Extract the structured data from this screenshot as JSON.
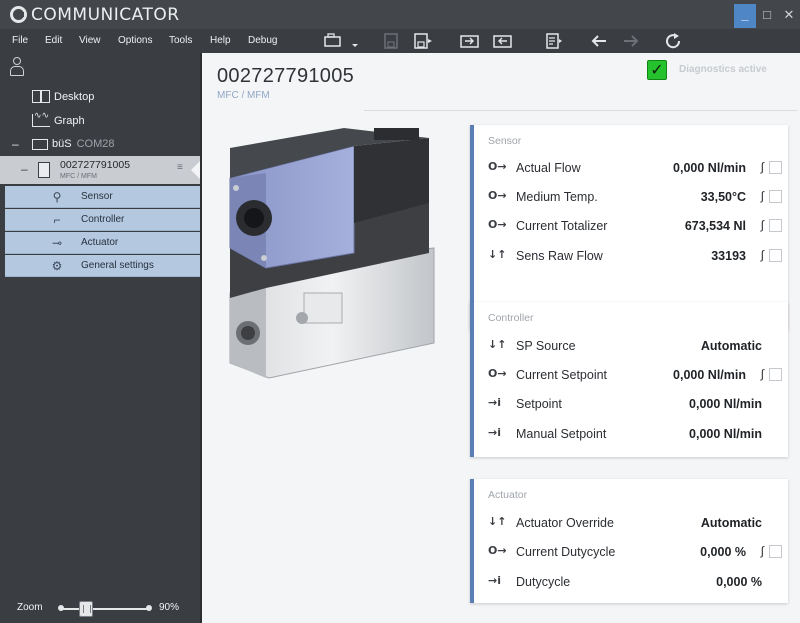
{
  "window": {
    "title": "COMMUNICATOR",
    "controls": [
      "_",
      "□",
      "✕"
    ]
  },
  "menu": [
    "File",
    "Edit",
    "View",
    "Options",
    "Tools",
    "Help",
    "Debug"
  ],
  "toolbar": {
    "icons": [
      "device-icon",
      "dropdown-icon",
      "save-disabled-icon",
      "save-icon",
      "import-icon",
      "export-icon",
      "report-icon",
      "back-icon",
      "forward-icon",
      "refresh-icon"
    ]
  },
  "sidebar": {
    "desktop": "Desktop",
    "graph": "Graph",
    "bus": "büS",
    "bus_port": "COM28",
    "collapse_symbol": "–",
    "device_id": "002727791005",
    "device_type": "MFC / MFM",
    "sub_items": [
      "Sensor",
      "Controller",
      "Actuator",
      "General settings"
    ],
    "zoom_label": "Zoom",
    "zoom_value": "90%",
    "zoom_level": 0.28
  },
  "main": {
    "device_id": "002727791005",
    "device_type": "MFC / MFM",
    "diagnostics_label": "Diagnostics active",
    "diagnostics_checked": true
  },
  "cards": [
    {
      "title": "Sensor",
      "rows": [
        {
          "icon": "O→",
          "label": "Actual Flow",
          "value": "0,000 Nl/min",
          "trend": true,
          "check": true
        },
        {
          "icon": "O→",
          "label": "Medium Temp.",
          "value": "33,50°C",
          "trend": true,
          "check": true
        },
        {
          "icon": "O→",
          "label": "Current Totalizer",
          "value": "673,534 Nl",
          "trend": true,
          "check": true
        },
        {
          "icon": "↓↑",
          "label": "Sens Raw Flow",
          "value": "33193",
          "trend": true,
          "check": true
        }
      ]
    },
    {
      "title": "Controller",
      "rows": [
        {
          "icon": "↓↑",
          "label": "SP Source",
          "value": "Automatic",
          "trend": false,
          "check": false
        },
        {
          "icon": "O→",
          "label": "Current Setpoint",
          "value": "0,000 Nl/min",
          "trend": true,
          "check": true
        },
        {
          "icon": "→i",
          "label": "Setpoint",
          "value": "0,000 Nl/min",
          "trend": false,
          "check": false
        },
        {
          "icon": "→i",
          "label": "Manual Setpoint",
          "value": "0,000 Nl/min",
          "trend": false,
          "check": false
        }
      ]
    },
    {
      "title": "Actuator",
      "rows": [
        {
          "icon": "↓↑",
          "label": "Actuator Override",
          "value": "Automatic",
          "trend": false,
          "check": false
        },
        {
          "icon": "O→",
          "label": "Current Dutycycle",
          "value": "0,000 %",
          "trend": true,
          "check": true
        },
        {
          "icon": "→i",
          "label": "Dutycycle",
          "value": "0,000 %",
          "trend": false,
          "check": false
        }
      ]
    }
  ],
  "colors": {
    "sidebar": "#3a3d42",
    "accent": "#5b7fb5",
    "selection": "#b4c8df",
    "check_green": "#26c22d"
  }
}
